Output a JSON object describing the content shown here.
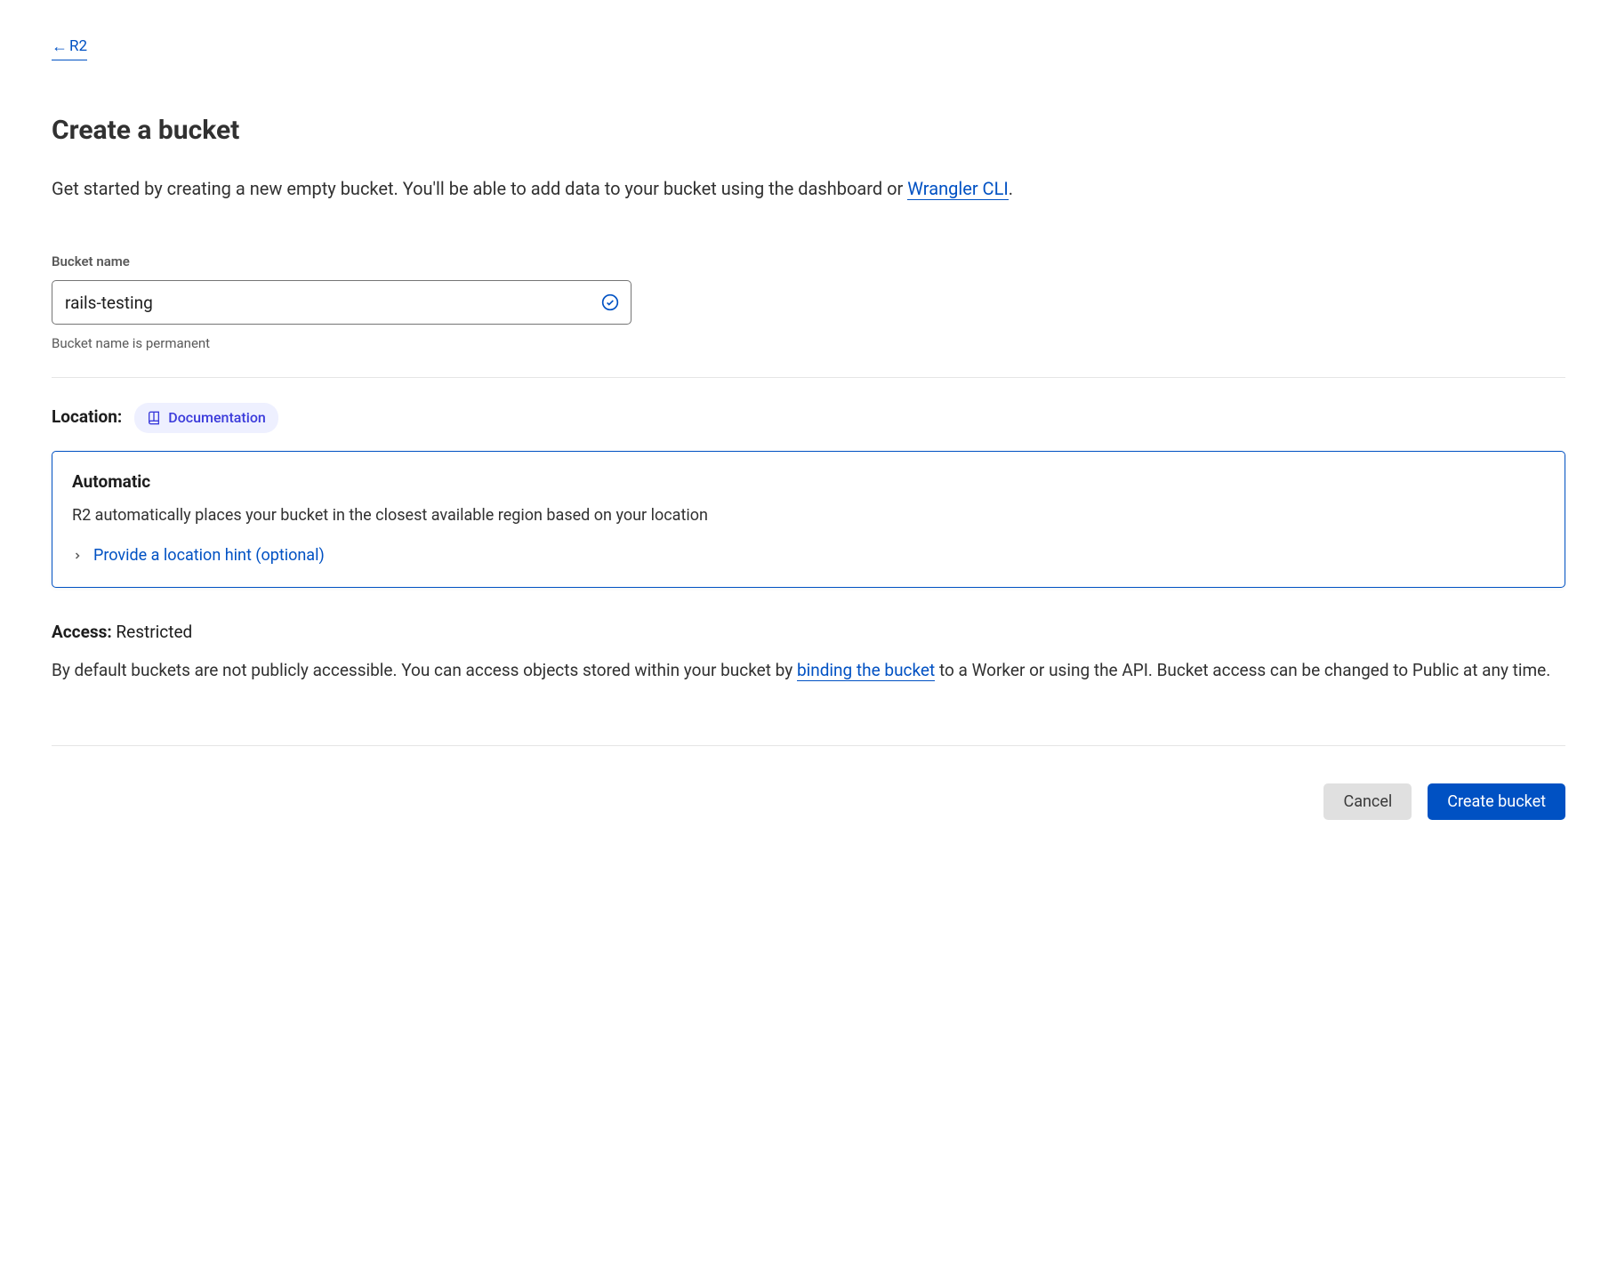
{
  "breadcrumb": {
    "back_label": "R2"
  },
  "page": {
    "title": "Create a bucket",
    "intro_prefix": "Get started by creating a new empty bucket. You'll be able to add data to your bucket using the dashboard or ",
    "intro_link": "Wrangler CLI",
    "intro_suffix": "."
  },
  "bucket_name": {
    "label": "Bucket name",
    "value": "rails-testing",
    "helper": "Bucket name is permanent"
  },
  "location": {
    "label": "Location:",
    "doc_link": "Documentation",
    "card_title": "Automatic",
    "card_desc": "R2 automatically places your bucket in the closest available region based on your location",
    "hint_label": "Provide a location hint (optional)"
  },
  "access": {
    "label": "Access:",
    "value": "Restricted",
    "desc_prefix": "By default buckets are not publicly accessible. You can access objects stored within your bucket by ",
    "desc_link": "binding the bucket",
    "desc_suffix": " to a Worker or using the API. Bucket access can be changed to Public at any time."
  },
  "buttons": {
    "cancel": "Cancel",
    "create": "Create bucket"
  }
}
